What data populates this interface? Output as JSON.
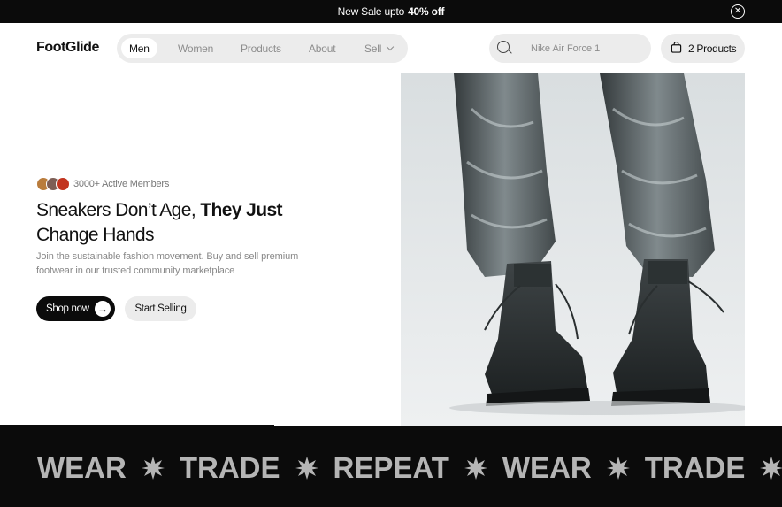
{
  "announcement": {
    "text": "New Sale upto",
    "highlight": "40% off",
    "close_icon": "close-circle-icon"
  },
  "header": {
    "logo": "FootGlide",
    "nav": [
      {
        "label": "Men",
        "active": true
      },
      {
        "label": "Women",
        "active": false
      },
      {
        "label": "Products",
        "active": false
      },
      {
        "label": "About",
        "active": false
      },
      {
        "label": "Sell",
        "active": false,
        "has_dropdown": true
      }
    ],
    "search": {
      "placeholder": "Nike Air Force 1",
      "icon": "search-icon"
    },
    "cart": {
      "label": "2 Products",
      "icon": "shopping-bag-icon"
    }
  },
  "hero": {
    "members_text": "3000+ Active Members",
    "headline_regular": "Sneakers Don’t Age,",
    "headline_bold": "They Just",
    "headline_line2": "Change Hands",
    "subtext": "Join the sustainable fashion movement. Buy and sell premium footwear in our trusted community marketplace",
    "primary_button": "Shop now",
    "secondary_button": "Start Selling"
  },
  "marquee": {
    "words": [
      "WEAR",
      "TRADE",
      "REPEAT",
      "WEAR",
      "TRADE"
    ]
  },
  "colors": {
    "dark": "#0b0b0b",
    "pill_bg": "#ececec",
    "muted_text": "#8d8d8d",
    "marquee_text": "#b5b5b5"
  }
}
